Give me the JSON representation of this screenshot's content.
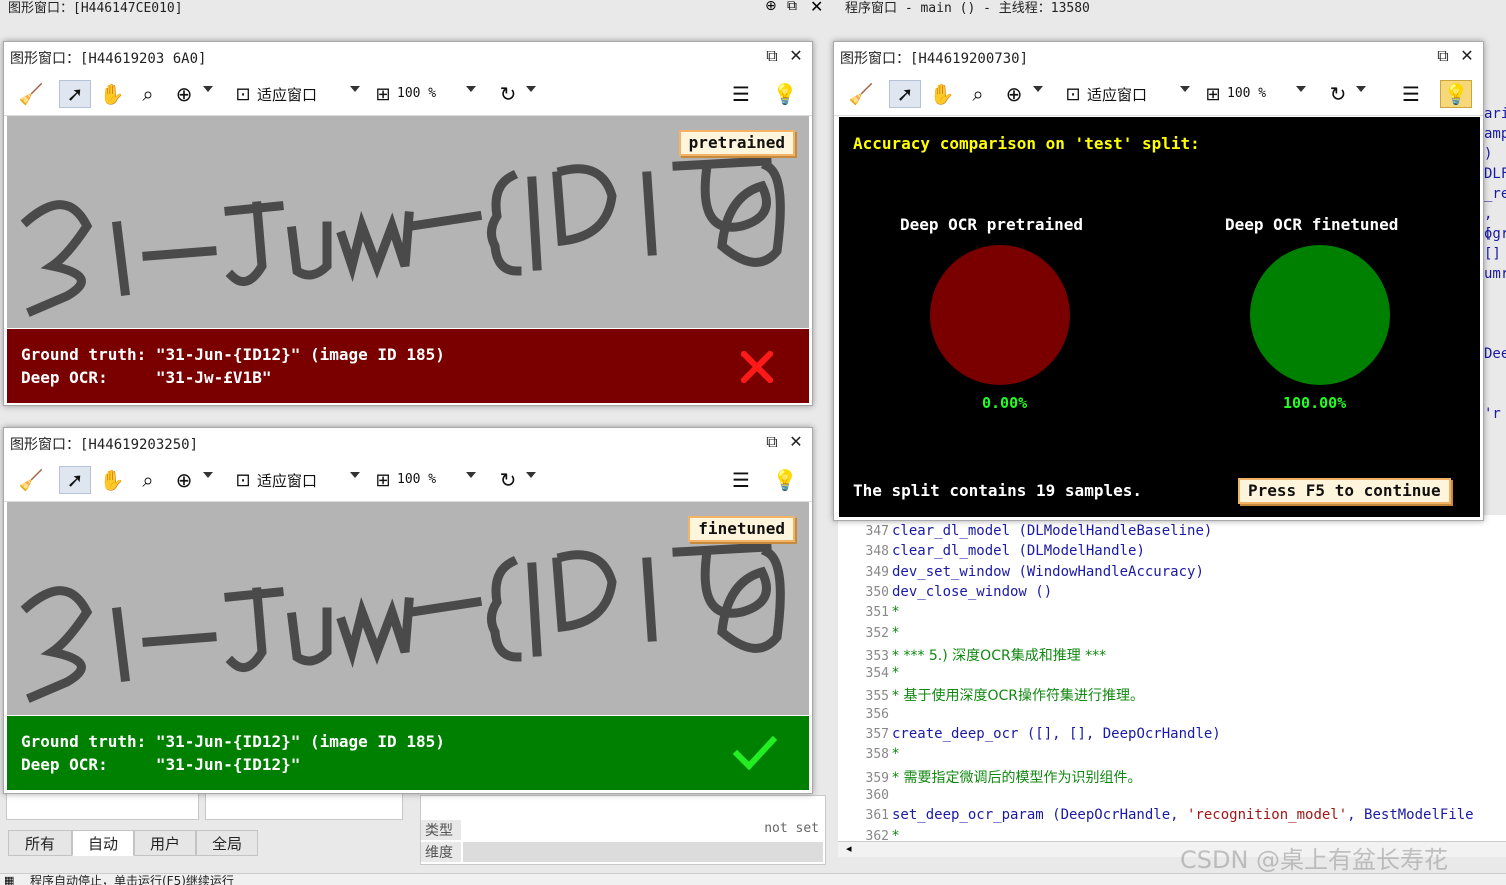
{
  "background": {
    "left_window_title": "图形窗口：[H446147CE010]",
    "program_window_title": "程序窗口 - main () - 主线程：13580",
    "right_edge_fragments": [
      "ari",
      "amp",
      ")",
      "DLF",
      "_re",
      ", [",
      "ogr",
      "[]",
      "umr",
      "Dee",
      "'r"
    ],
    "tabs": [
      "所有",
      "自动",
      "用户",
      "全局"
    ],
    "prop_type_label": "类型",
    "prop_dim_label": "维度",
    "prop_type_value": "not set",
    "status_text": "程序自动停止，单击运行(F5)继续运行",
    "watermark": "CSDN @桌上有盆长寿花"
  },
  "code_lines": [
    {
      "num": "347",
      "fn": "clear_dl_model",
      "args": " (DLModelHandleBaseline)",
      "kind": "code"
    },
    {
      "num": "348",
      "fn": "clear_dl_model",
      "args": " (DLModelHandle)",
      "kind": "code"
    },
    {
      "num": "349",
      "fn": "dev_set_window",
      "args": " (WindowHandleAccuracy)",
      "kind": "code"
    },
    {
      "num": "350",
      "fn": "dev_close_window",
      "args": " ()",
      "kind": "code"
    },
    {
      "num": "351",
      "text": "*",
      "kind": "comment"
    },
    {
      "num": "352",
      "text": "*",
      "kind": "comment"
    },
    {
      "num": "353",
      "text": "* ***   5.) 深度OCR集成和推理   ***",
      "kind": "comment"
    },
    {
      "num": "354",
      "text": "*",
      "kind": "comment"
    },
    {
      "num": "355",
      "text": "* 基于使用深度OCR操作符集进行推理。",
      "kind": "comment"
    },
    {
      "num": "356",
      "text": "",
      "kind": "comment"
    },
    {
      "num": "357",
      "fn": "create_deep_ocr",
      "args": " ([], [], DeepOcrHandle)",
      "kind": "code"
    },
    {
      "num": "358",
      "text": "*",
      "kind": "comment"
    },
    {
      "num": "359",
      "text": "* 需要指定微调后的模型作为识别组件。",
      "kind": "comment"
    },
    {
      "num": "360",
      "text": "",
      "kind": "comment"
    },
    {
      "num": "361",
      "fn": "set_deep_ocr_param",
      "args": " (DeepOcrHandle, ",
      "str": "'recognition_model'",
      "args2": ", BestModelFile",
      "kind": "code"
    },
    {
      "num": "362",
      "text": "*",
      "kind": "comment"
    }
  ],
  "toolbar": {
    "fit_label": "适应窗口",
    "zoom_value": "100 %"
  },
  "win_pretrained": {
    "title": "图形窗口：[H44619203 6A0]",
    "tag": "pretrained",
    "gt_line": "Ground truth: \"31-Jun-{ID12}\" (image ID 185)",
    "ocr_line": "Deep OCR:     \"31-Jw-£V1B\"",
    "result": "fail",
    "bar_color": "#7a0000"
  },
  "win_finetuned": {
    "title": "图形窗口：[H44619203250]",
    "tag": "finetuned",
    "gt_line": "Ground truth: \"31-Jun-{ID12}\" (image ID 185)",
    "ocr_line": "Deep OCR:     \"31-Jun-{ID12}\"",
    "result": "pass",
    "bar_color": "#008000"
  },
  "win_accuracy": {
    "title": "图形窗口：[H44619200730]",
    "heading": "Accuracy comparison on 'test' split:",
    "left_label": "Deep OCR pretrained",
    "right_label": "Deep OCR finetuned",
    "left_value": "0.00%",
    "right_value": "100.00%",
    "left_color": "#7a0000",
    "right_color": "#008000",
    "footer": "The split contains 19 samples.",
    "continue_label": "Press F5 to continue"
  }
}
